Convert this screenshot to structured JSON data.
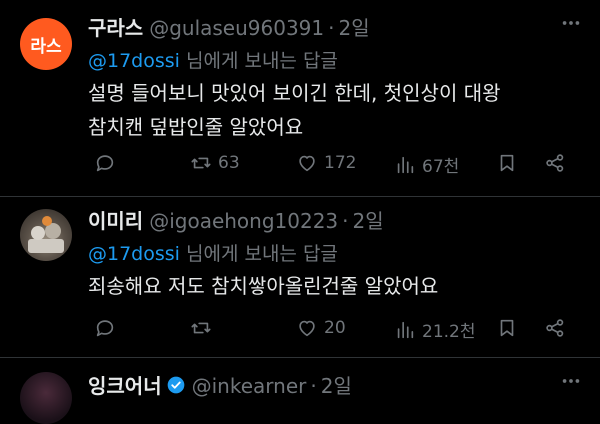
{
  "tweets": [
    {
      "avatar_text": "라스",
      "name": "구라스",
      "handle": "@gulaseu960391",
      "time": "2일",
      "reply_mention": "@17dossi",
      "reply_suffix": " 님에게 보내는 답글",
      "lines": [
        "설명 들어보니 맛있어 보이긴 한데, 첫인상이 대왕",
        "참치캔 덮밥인줄 알았어요"
      ],
      "retweets": "63",
      "likes": "172",
      "views": "67천"
    },
    {
      "name": "이미리",
      "handle": "@igoaehong10223",
      "time": "2일",
      "reply_mention": "@17dossi",
      "reply_suffix": " 님에게 보내는 답글",
      "lines": [
        "죄송해요 저도 참치쌓아올린건줄 알았어요"
      ],
      "retweets": "",
      "likes": "20",
      "views": "21.2천"
    },
    {
      "name": "잉크어너",
      "handle": "@inkearner",
      "time": "2일"
    }
  ],
  "colors": {
    "accent": "#1d9bf0",
    "avatar_orange": "#ff5a1f",
    "muted": "#71767b"
  },
  "icons": [
    "reply-icon",
    "retweet-icon",
    "like-icon",
    "views-icon",
    "bookmark-icon",
    "share-icon",
    "more-icon",
    "verified-icon"
  ]
}
